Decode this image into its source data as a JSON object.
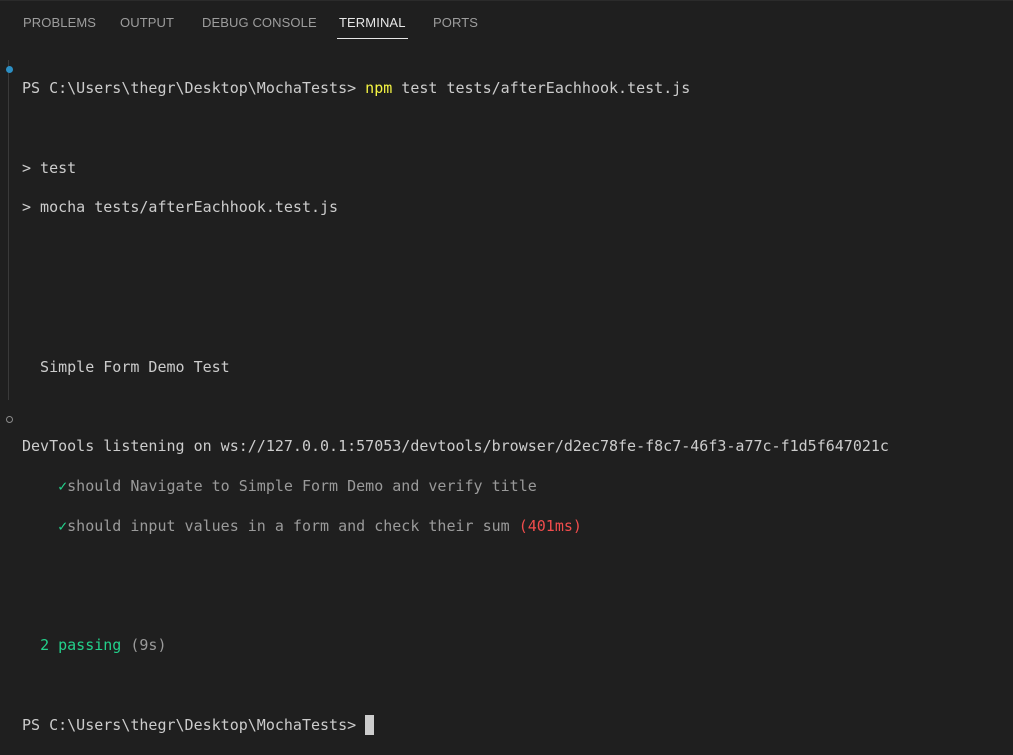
{
  "tabs": [
    "PROBLEMS",
    "OUTPUT",
    "DEBUG CONSOLE",
    "TERMINAL",
    "PORTS"
  ],
  "active_tab": "TERMINAL",
  "terminal": {
    "prompt": "PS C:\\Users\\thegr\\Desktop\\MochaTests> ",
    "cmd_npm": "npm",
    "cmd_rest": " test tests/afterEachhook.test.js",
    "out1": "> test",
    "out2": "> mocha tests/afterEachhook.test.js",
    "suite": "  Simple Form Demo Test",
    "devtools": "DevTools listening on ws://127.0.0.1:57053/devtools/browser/d2ec78fe-f8c7-46f3-a77c-f1d5f647021c",
    "check": "✓",
    "test1": "should Navigate to Simple Form Demo and verify title",
    "test2": "should input values in a form and check their sum",
    "test2_time": "(401ms)",
    "passing": "2 passing",
    "passing_time": "(9s)"
  },
  "colors": {
    "success_decoration": "#2c8fc4",
    "accent": "#23d18b"
  }
}
